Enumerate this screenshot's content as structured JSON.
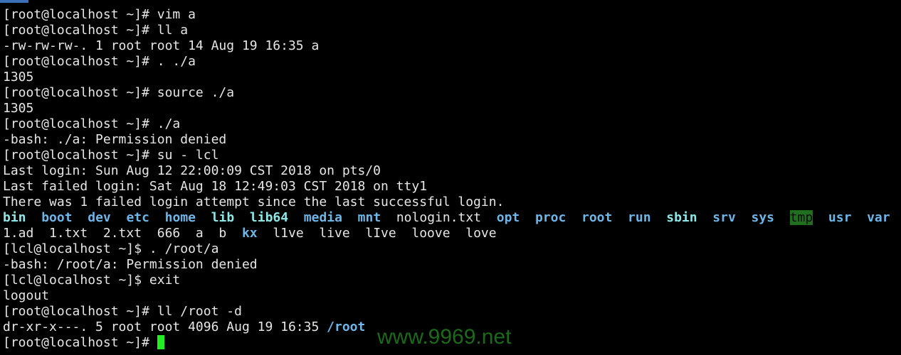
{
  "terminal": {
    "lines": [
      [
        {
          "t": "[root@localhost ~]# vim a"
        }
      ],
      [
        {
          "t": "[root@localhost ~]# ll a"
        }
      ],
      [
        {
          "t": "-rw-rw-rw-. 1 root root 14 Aug 19 16:35 a"
        }
      ],
      [
        {
          "t": "[root@localhost ~]# . ./a"
        }
      ],
      [
        {
          "t": "1305"
        }
      ],
      [
        {
          "t": "[root@localhost ~]# source ./a"
        }
      ],
      [
        {
          "t": "1305"
        }
      ],
      [
        {
          "t": "[root@localhost ~]# ./a"
        }
      ],
      [
        {
          "t": "-bash: ./a: Permission denied"
        }
      ],
      [
        {
          "t": "[root@localhost ~]# su - lcl"
        }
      ],
      [
        {
          "t": "Last login: Sun Aug 12 22:00:09 CST 2018 on pts/0"
        }
      ],
      [
        {
          "t": "Last failed login: Sat Aug 18 12:49:03 CST 2018 on tty1"
        }
      ],
      [
        {
          "t": "There was 1 failed login attempt since the last successful login."
        }
      ],
      [
        {
          "t": "bin",
          "c": "link"
        },
        {
          "t": "  "
        },
        {
          "t": "boot",
          "c": "dir"
        },
        {
          "t": "  "
        },
        {
          "t": "dev",
          "c": "dir"
        },
        {
          "t": "  "
        },
        {
          "t": "etc",
          "c": "dir"
        },
        {
          "t": "  "
        },
        {
          "t": "home",
          "c": "dir"
        },
        {
          "t": "  "
        },
        {
          "t": "lib",
          "c": "link"
        },
        {
          "t": "  "
        },
        {
          "t": "lib64",
          "c": "link"
        },
        {
          "t": "  "
        },
        {
          "t": "media",
          "c": "dir"
        },
        {
          "t": "  "
        },
        {
          "t": "mnt",
          "c": "dir"
        },
        {
          "t": "  nologin.txt  "
        },
        {
          "t": "opt",
          "c": "dir"
        },
        {
          "t": "  "
        },
        {
          "t": "proc",
          "c": "dir"
        },
        {
          "t": "  "
        },
        {
          "t": "root",
          "c": "dir"
        },
        {
          "t": "  "
        },
        {
          "t": "run",
          "c": "dir"
        },
        {
          "t": "  "
        },
        {
          "t": "sbin",
          "c": "link"
        },
        {
          "t": "  "
        },
        {
          "t": "srv",
          "c": "dir"
        },
        {
          "t": "  "
        },
        {
          "t": "sys",
          "c": "dir"
        },
        {
          "t": "  "
        },
        {
          "t": "tmp",
          "c": "sticky"
        },
        {
          "t": "  "
        },
        {
          "t": "usr",
          "c": "dir"
        },
        {
          "t": "  "
        },
        {
          "t": "var",
          "c": "dir"
        }
      ],
      [
        {
          "t": "1.ad  1.txt  2.txt  666  a  b  "
        },
        {
          "t": "kx",
          "c": "dir"
        },
        {
          "t": "  l1ve  live  lIve  loove  love"
        }
      ],
      [
        {
          "t": "[lcl@localhost ~]$ . /root/a"
        }
      ],
      [
        {
          "t": "-bash: /root/a: Permission denied"
        }
      ],
      [
        {
          "t": "[lcl@localhost ~]$ exit"
        }
      ],
      [
        {
          "t": "logout"
        }
      ],
      [
        {
          "t": "[root@localhost ~]# ll /root -d"
        }
      ],
      [
        {
          "t": "dr-xr-x---. 5 root root 4096 Aug 19 16:35 "
        },
        {
          "t": "/root",
          "c": "dir"
        }
      ],
      [
        {
          "t": "[root@localhost ~]# "
        },
        {
          "cursor": true
        }
      ]
    ]
  },
  "watermark": "www.9969.net",
  "colors": {
    "background": "#000000",
    "text": "#e6e6e6",
    "directory": "#6cb6ea",
    "symlink": "#8ee8e8",
    "sticky_bg": "#1f6f1f",
    "cursor": "#22ee22"
  }
}
